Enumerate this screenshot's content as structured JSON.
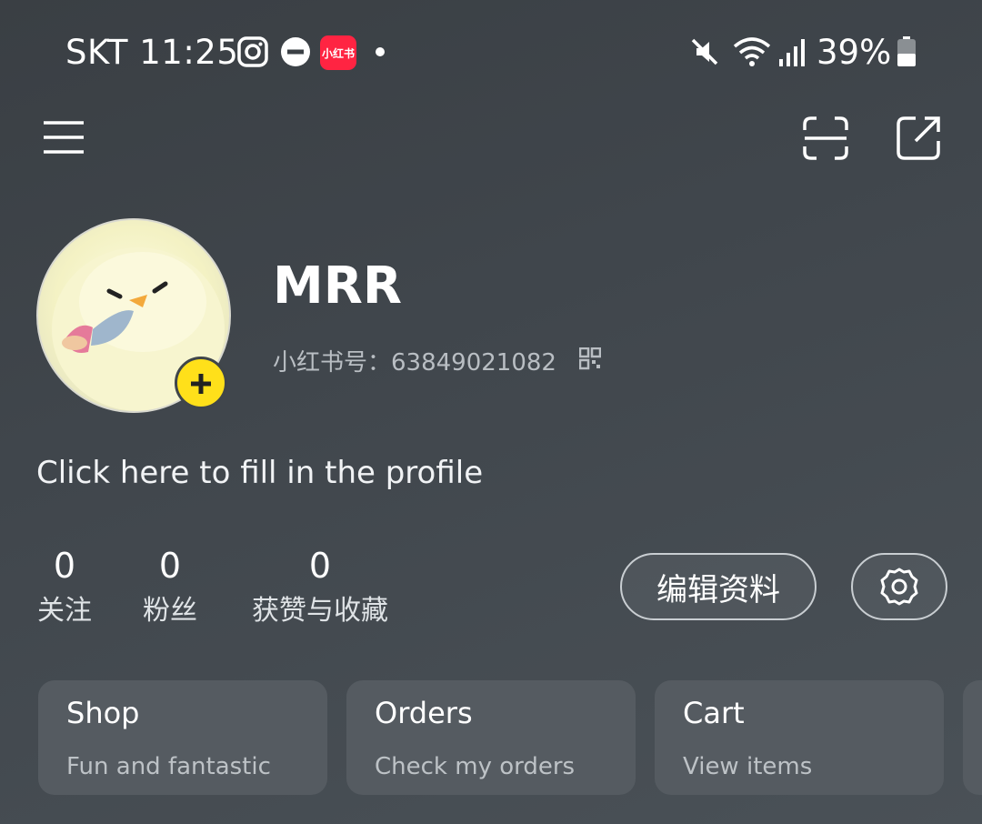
{
  "status_bar": {
    "carrier_time": "SKT 11:25",
    "redbook_app_badge": "小红书",
    "battery": "39%"
  },
  "profile": {
    "username": "MRR",
    "redbook_id": "小红书号：63849021082",
    "bio_prompt": "Click here to fill in the profile"
  },
  "stats": [
    {
      "value": "0",
      "label": "关注"
    },
    {
      "value": "0",
      "label": "粉丝"
    },
    {
      "value": "0",
      "label": "获赞与收藏"
    }
  ],
  "actions": {
    "edit_profile": "编辑资料"
  },
  "cards": [
    {
      "title": "Shop",
      "subtitle": "Fun and fantastic"
    },
    {
      "title": "Orders",
      "subtitle": "Check my orders"
    },
    {
      "title": "Cart",
      "subtitle": "View items"
    }
  ],
  "colors": {
    "accent_yellow": "#ffe01a",
    "brand_red": "#ff2442",
    "card_bg": "#555b61"
  },
  "icons": [
    "instagram-icon",
    "dnd-icon",
    "mute-icon",
    "wifi-icon",
    "signal-icon",
    "battery-icon",
    "menu-icon",
    "scan-icon",
    "share-icon",
    "qr-code-icon",
    "settings-icon",
    "add-icon"
  ]
}
